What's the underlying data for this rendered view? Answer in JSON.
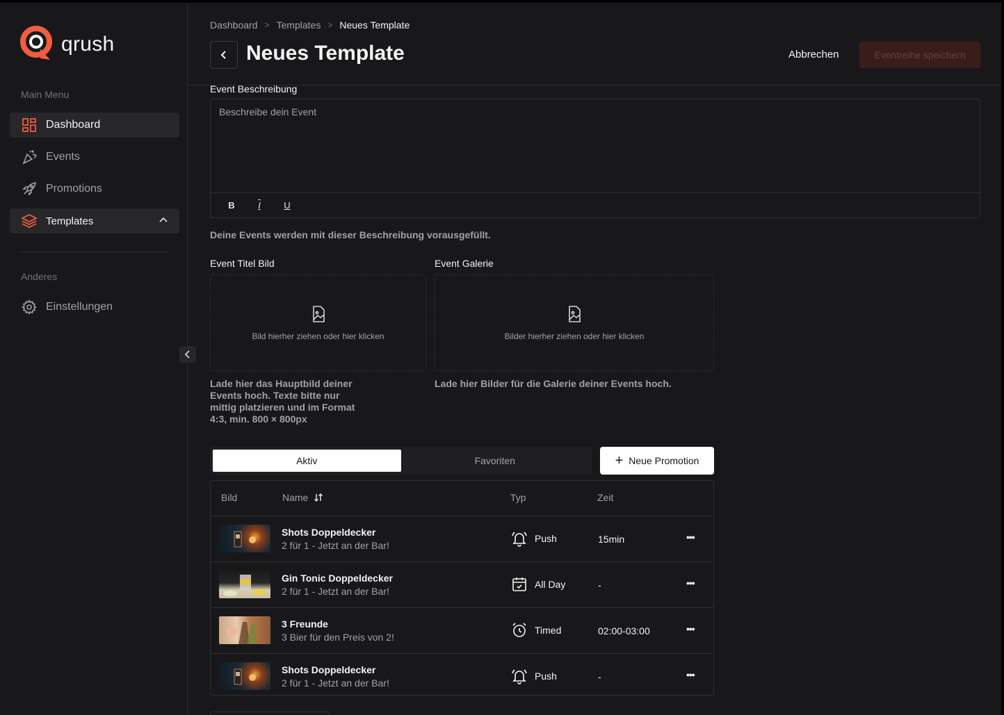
{
  "brand": {
    "name": "qrush",
    "accent": "#f25c3f"
  },
  "sidebar": {
    "main_menu_label": "Main Menu",
    "other_label": "Anderes",
    "items": [
      {
        "label": "Dashboard",
        "icon": "dashboard-grid-icon"
      },
      {
        "label": "Events",
        "icon": "party-popper-icon"
      },
      {
        "label": "Promotions",
        "icon": "rocket-icon"
      },
      {
        "label": "Templates",
        "icon": "layers-icon"
      }
    ],
    "settings": {
      "label": "Einstellungen",
      "icon": "gear-icon"
    }
  },
  "header": {
    "breadcrumb": [
      "Dashboard",
      "Templates",
      "Neues Template"
    ],
    "title": "Neues Template",
    "cancel_label": "Abbrechen",
    "save_label": "Eventreihe speichern"
  },
  "description": {
    "label": "Event Beschreibung",
    "placeholder": "Beschreibe dein Event",
    "toolbar": [
      "B",
      "I",
      "U"
    ],
    "helper": "Deine Events werden mit dieser Beschreibung vorausgefüllt."
  },
  "title_image": {
    "label": "Event Titel Bild",
    "drop_text": "Bild hierher ziehen oder hier klicken",
    "helper": [
      "Lade hier das Hauptbild deiner",
      "Events hoch. Texte bitte nur",
      "mittig platzieren und im Format",
      "4:3, min. 800 × 800px"
    ]
  },
  "gallery": {
    "label": "Event Galerie",
    "drop_text": "Bilder hierher ziehen oder hier klicken",
    "helper": "Lade hier Bilder für die Galerie deiner Events hoch."
  },
  "promotions": {
    "tabs": [
      "Aktiv",
      "Favoriten"
    ],
    "active_tab": "Aktiv",
    "new_label": "Neue Promotion",
    "columns": [
      "Bild",
      "Name",
      "Typ",
      "Zeit"
    ],
    "rows": [
      {
        "name": "Shots Doppeldecker",
        "sub": "2 für 1 - Jetzt an der Bar!",
        "type": "Push",
        "type_icon": "bell-ringing-icon",
        "time": "15min",
        "thumb": "shots"
      },
      {
        "name": "Gin Tonic Doppeldecker",
        "sub": "2 für 1 - Jetzt an der Bar!",
        "type": "All Day",
        "type_icon": "calendar-check-icon",
        "time": "-",
        "thumb": "gin"
      },
      {
        "name": "3 Freunde",
        "sub": "3 Bier für den Preis von 2!",
        "type": "Timed",
        "type_icon": "alarm-clock-icon",
        "time": "02:00-03:00",
        "thumb": "beer"
      },
      {
        "name": "Shots Doppeldecker",
        "sub": "2 für 1 - Jetzt an der Bar!",
        "type": "Push",
        "type_icon": "bell-ringing-icon",
        "time": "-",
        "thumb": "shots"
      }
    ],
    "more_glyph": "•••"
  }
}
